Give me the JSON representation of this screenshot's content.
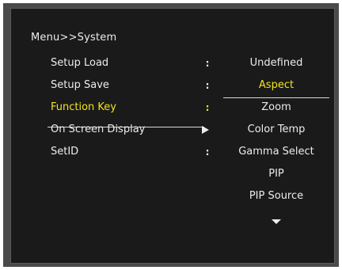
{
  "breadcrumb": "Menu>>System",
  "menu": {
    "items": [
      {
        "label": "Setup Load",
        "separator": ":"
      },
      {
        "label": "Setup Save",
        "separator": ":"
      },
      {
        "label": "Function Key",
        "separator": ":"
      },
      {
        "label": "On Screen Display",
        "separator": "arrow-right-icon"
      },
      {
        "label": "SetID",
        "separator": ":"
      }
    ],
    "selected_index": 2
  },
  "options": {
    "items": [
      "Undefined",
      "Aspect",
      "Zoom",
      "Color Temp",
      "Gamma Select",
      "PIP",
      "PIP Source"
    ],
    "selected_index": 1,
    "more_indicator": "arrow-down-icon"
  },
  "colors": {
    "text": "#ececec",
    "highlight": "#f2e41c",
    "panel_bg": "#1a1a1a",
    "frame_bg": "#4a4a4a"
  }
}
